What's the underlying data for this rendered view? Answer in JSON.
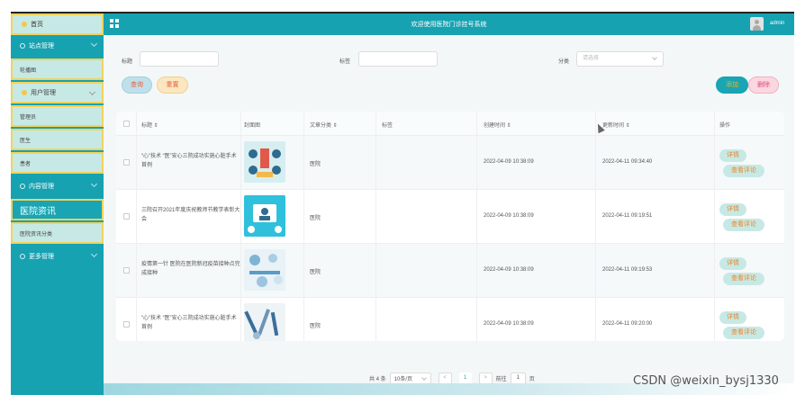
{
  "header": {
    "title": "欢迎使用医院门诊挂号系统",
    "user": "admin"
  },
  "sidebar": {
    "home": "首页",
    "groups": [
      {
        "label": "站点管理",
        "items": [
          "轮播图"
        ]
      },
      {
        "label": "用户管理",
        "items": [
          "管理员",
          "医生",
          "患者"
        ]
      },
      {
        "label": "内容管理",
        "items": [
          "医院资讯",
          "医院资讯分类"
        ]
      },
      {
        "label": "更多管理",
        "items": []
      }
    ]
  },
  "filters": {
    "title_label": "标题",
    "tag_label": "标签",
    "category_label": "分类",
    "category_placeholder": "请选择"
  },
  "buttons": {
    "search": "查询",
    "reset": "重置",
    "add": "添加",
    "delete": "删除"
  },
  "table": {
    "columns": [
      "标题",
      "封面图",
      "文章分类",
      "标签",
      "创建时间",
      "更新时间",
      "操作"
    ],
    "rows": [
      {
        "title": "“心”技术 “医”安心三院成功实施心脏手术 首例",
        "category": "医院",
        "created": "2022-04-09 10:38:09",
        "updated": "2022-04-11 09:34:40",
        "detail": "详情",
        "comments": "查看评论"
      },
      {
        "title": "三院召开2021年度庆祝教师节教学表彰大会",
        "category": "医院",
        "created": "2022-04-09 10:38:09",
        "updated": "2022-04-11 09:19:51",
        "detail": "详情",
        "comments": "查看评论"
      },
      {
        "title": "疫情第一针 医院在医院新冠疫苗接种点完成接种",
        "category": "医院",
        "created": "2022-04-09 10:38:09",
        "updated": "2022-04-11 09:19:53",
        "detail": "详情",
        "comments": "查看评论"
      },
      {
        "title": "“心”技术 “医”安心三院成功实施心脏手术 首例",
        "category": "医院",
        "created": "2022-04-09 10:38:09",
        "updated": "2022-04-11 09:20:00",
        "detail": "详情",
        "comments": "查看评论"
      }
    ]
  },
  "pager": {
    "total": "共 4 条",
    "page_size": "10条/页",
    "current_page": "1",
    "goto_label": "前往",
    "goto_value": "1",
    "goto_unit": "页",
    "prev": "<",
    "next": ">"
  },
  "watermark": "CSDN @weixin_bysj1330",
  "colors": {
    "accent": "#16a2b1",
    "highlight_border": "#f1d35d",
    "sidebar_item_bg": "#c7e9e5"
  }
}
